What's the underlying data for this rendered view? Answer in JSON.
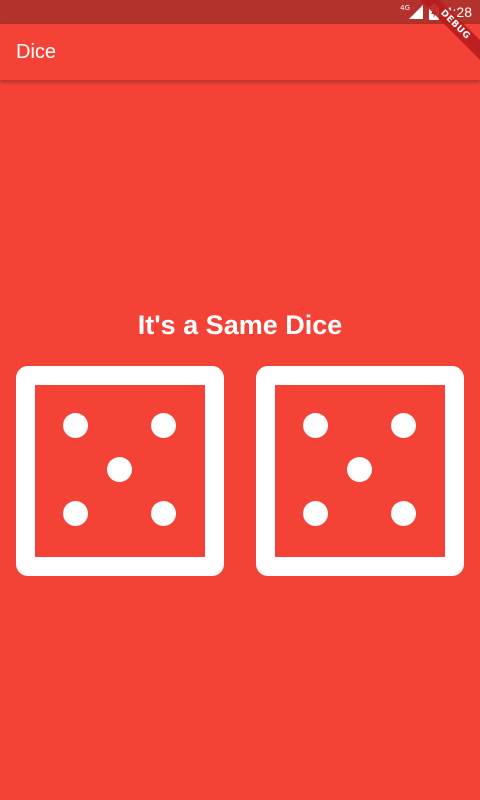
{
  "status_bar": {
    "network_label": "4G",
    "time": "4:28"
  },
  "app_bar": {
    "title": "Dice"
  },
  "debug_banner": {
    "label": "DEBUG"
  },
  "main": {
    "headline": "It's a Same Dice",
    "dice": [
      {
        "value": 5
      },
      {
        "value": 5
      }
    ]
  },
  "colors": {
    "primary": "#F44336",
    "status_bar": "#B3322C",
    "foreground": "#FFFFFF"
  }
}
